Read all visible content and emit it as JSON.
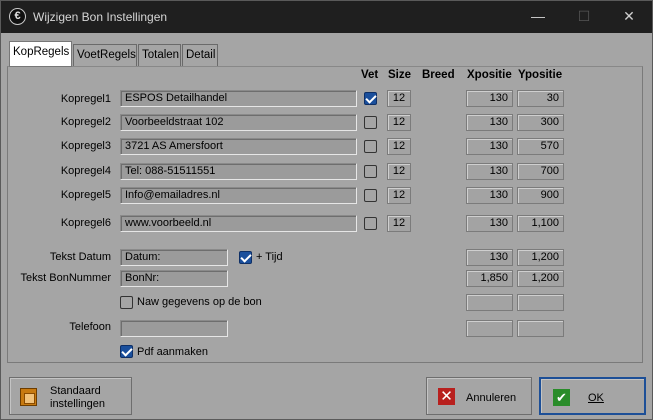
{
  "window": {
    "title": "Wijzigen Bon Instellingen",
    "icon_glyph": "€",
    "min_glyph": "—",
    "max_glyph": "☐",
    "close_glyph": "✕"
  },
  "tabs": [
    "KopRegels",
    "VoetRegels",
    "Totalen",
    "Detail"
  ],
  "columns": {
    "vet": "Vet",
    "size": "Size",
    "breed": "Breed",
    "xpos": "Xpositie",
    "ypos": "Ypositie"
  },
  "rows": [
    {
      "label": "Kopregel1",
      "text": "ESPOS Detailhandel",
      "vet": true,
      "size": "12",
      "x": "130",
      "y": "30"
    },
    {
      "label": "Kopregel2",
      "text": "Voorbeeldstraat 102",
      "vet": false,
      "size": "12",
      "x": "130",
      "y": "300"
    },
    {
      "label": "Kopregel3",
      "text": "3721 AS  Amersfoort",
      "vet": false,
      "size": "12",
      "x": "130",
      "y": "570"
    },
    {
      "label": "Kopregel4",
      "text": "Tel: 088-51511551",
      "vet": false,
      "size": "12",
      "x": "130",
      "y": "700"
    },
    {
      "label": "Kopregel5",
      "text": "Info@emailadres.nl",
      "vet": false,
      "size": "12",
      "x": "130",
      "y": "900"
    },
    {
      "label": "Kopregel6",
      "text": "www.voorbeeld.nl",
      "vet": false,
      "size": "12",
      "x": "130",
      "y": "1,100"
    }
  ],
  "tekst_datum": {
    "label": "Tekst Datum",
    "value": "Datum:",
    "tijd_label": "+ Tijd",
    "tijd_checked": true,
    "x": "130",
    "y": "1,200"
  },
  "tekst_bonnummer": {
    "label": "Tekst BonNummer",
    "value": "BonNr:",
    "x": "1,850",
    "y": "1,200"
  },
  "naw": {
    "label": "Naw gegevens op de bon",
    "checked": false
  },
  "telefoon": {
    "label": "Telefoon",
    "value": ""
  },
  "pdf": {
    "label": "Pdf aanmaken",
    "checked": true
  },
  "buttons": {
    "standaard_line1": "Standaard",
    "standaard_line2": "instellingen",
    "annuleren": "Annuleren",
    "ok": "OK"
  }
}
